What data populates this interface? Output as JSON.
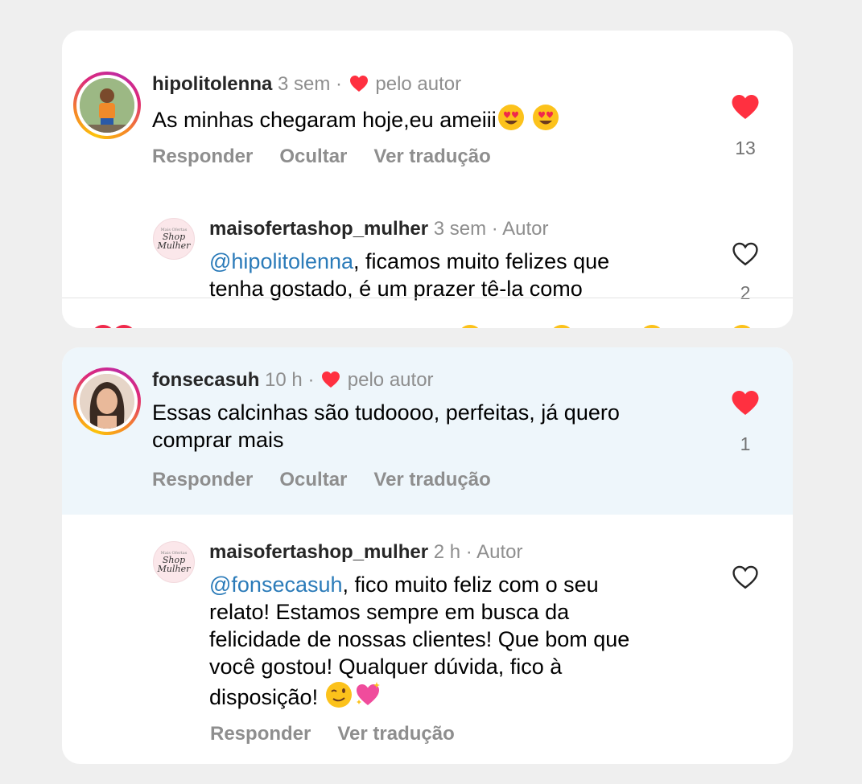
{
  "comments": [
    {
      "username": "hipolitolenna",
      "time": "3 sem",
      "liked_by_author": "pelo autor",
      "text": "As minhas chegaram hoje,eu ameiii",
      "actions": [
        "Responder",
        "Ocultar",
        "Ver tradução"
      ],
      "likes": "13",
      "liked": true,
      "reply": {
        "username": "maisofertashop_mulher",
        "time": "3 sem",
        "role": "Autor",
        "mention": "@hipolitolenna",
        "text_line1": ", ficamos muito felizes que",
        "text_line2": "tenha gostado, é um prazer tê-la como",
        "likes": "2"
      }
    },
    {
      "username": "fonsecasuh",
      "time": "10 h",
      "liked_by_author": "pelo autor",
      "text_line1": "Essas calcinhas são tudoooo, perfeitas, já quero",
      "text_line2": "comprar mais",
      "actions": [
        "Responder",
        "Ocultar",
        "Ver tradução"
      ],
      "likes": "1",
      "liked": true,
      "reply": {
        "username": "maisofertashop_mulher",
        "time": "2 h",
        "role": "Autor",
        "mention": "@fonsecasuh",
        "text_line1": ", fico muito feliz com o seu",
        "text_line2": "relato! Estamos sempre em busca da",
        "text_line3": "felicidade de nossas clientes! Que bom que",
        "text_line4": "você gostou! Qualquer dúvida, fico à",
        "text_line5": "disposição!",
        "actions": [
          "Responder",
          "Ver tradução"
        ]
      }
    }
  ],
  "brand_avatar": {
    "line1": "Mais Ofertas",
    "line2": "Shop",
    "line3": "Mulher"
  },
  "colors": {
    "like_red": "#ff3040",
    "mention_blue": "#2b7bb9",
    "meta_gray": "#8e8e8e",
    "highlight_bg": "#eef6fb"
  },
  "icons": [
    "heart-filled-icon",
    "heart-outline-icon",
    "heart-eyes-emoji",
    "wink-emoji",
    "sparkling-heart-emoji"
  ]
}
